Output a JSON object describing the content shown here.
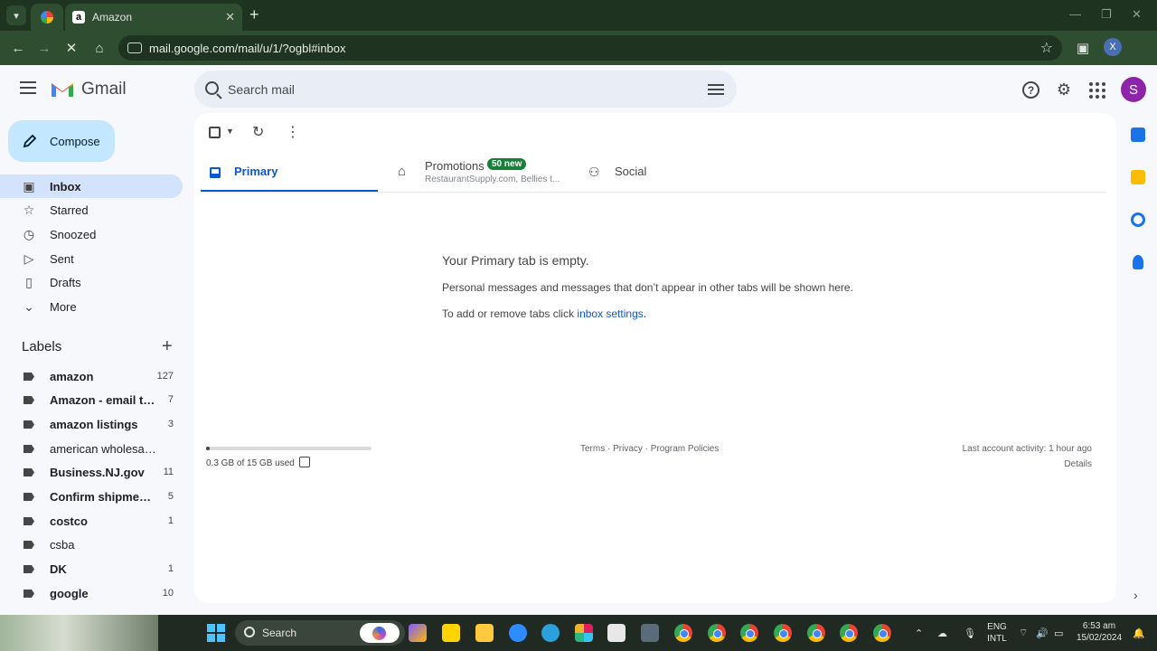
{
  "browser": {
    "tabs": [
      {
        "title": "",
        "icon": "chrome-extension-favicon"
      },
      {
        "title": "Amazon",
        "icon": "amazon-favicon"
      }
    ],
    "url": "mail.google.com/mail/u/1/?ogbl#inbox",
    "profile_initial": "X"
  },
  "gmail": {
    "logo_text": "Gmail",
    "search_placeholder": "Search mail",
    "avatar_initial": "S",
    "compose_label": "Compose",
    "nav": [
      {
        "label": "Inbox",
        "icon": "inbox-icon",
        "active": true
      },
      {
        "label": "Starred",
        "icon": "star-icon"
      },
      {
        "label": "Snoozed",
        "icon": "clock-icon"
      },
      {
        "label": "Sent",
        "icon": "send-icon"
      },
      {
        "label": "Drafts",
        "icon": "draft-icon"
      },
      {
        "label": "More",
        "icon": "chevron-down-icon"
      }
    ],
    "labels_header": "Labels",
    "labels": [
      {
        "name": "amazon",
        "count": "127",
        "bold": true
      },
      {
        "name": "Amazon - email to ...",
        "count": "7",
        "bold": true
      },
      {
        "name": "amazon listings",
        "count": "3",
        "bold": true
      },
      {
        "name": "american wholesaler",
        "count": "",
        "bold": false
      },
      {
        "name": "Business.NJ.gov",
        "count": "11",
        "bold": true
      },
      {
        "name": "Confirm shipment ...",
        "count": "5",
        "bold": true
      },
      {
        "name": "costco",
        "count": "1",
        "bold": true
      },
      {
        "name": "csba",
        "count": "",
        "bold": false
      },
      {
        "name": "DK",
        "count": "1",
        "bold": true
      },
      {
        "name": "google",
        "count": "10",
        "bold": true
      }
    ],
    "tabs": {
      "primary": "Primary",
      "promotions": "Promotions",
      "promotions_badge": "50 new",
      "promotions_sub": "RestaurantSupply.com, Bellies t...",
      "social": "Social"
    },
    "empty": {
      "title": "Your Primary tab is empty.",
      "description": "Personal messages and messages that don’t appear in other tabs will be shown here.",
      "settings_prefix": "To add or remove tabs click ",
      "settings_link": "inbox settings",
      "settings_suffix": "."
    },
    "footer": {
      "storage_text": "0.3 GB of 15 GB used",
      "storage_fraction": 0.02,
      "links": "Terms · Privacy · Program Policies",
      "activity": "Last account activity: 1 hour ago",
      "details": "Details"
    }
  },
  "taskbar": {
    "search_label": "Search",
    "language": "ENG",
    "layout": "INTL",
    "time": "6:53 am",
    "date": "15/02/2024"
  }
}
